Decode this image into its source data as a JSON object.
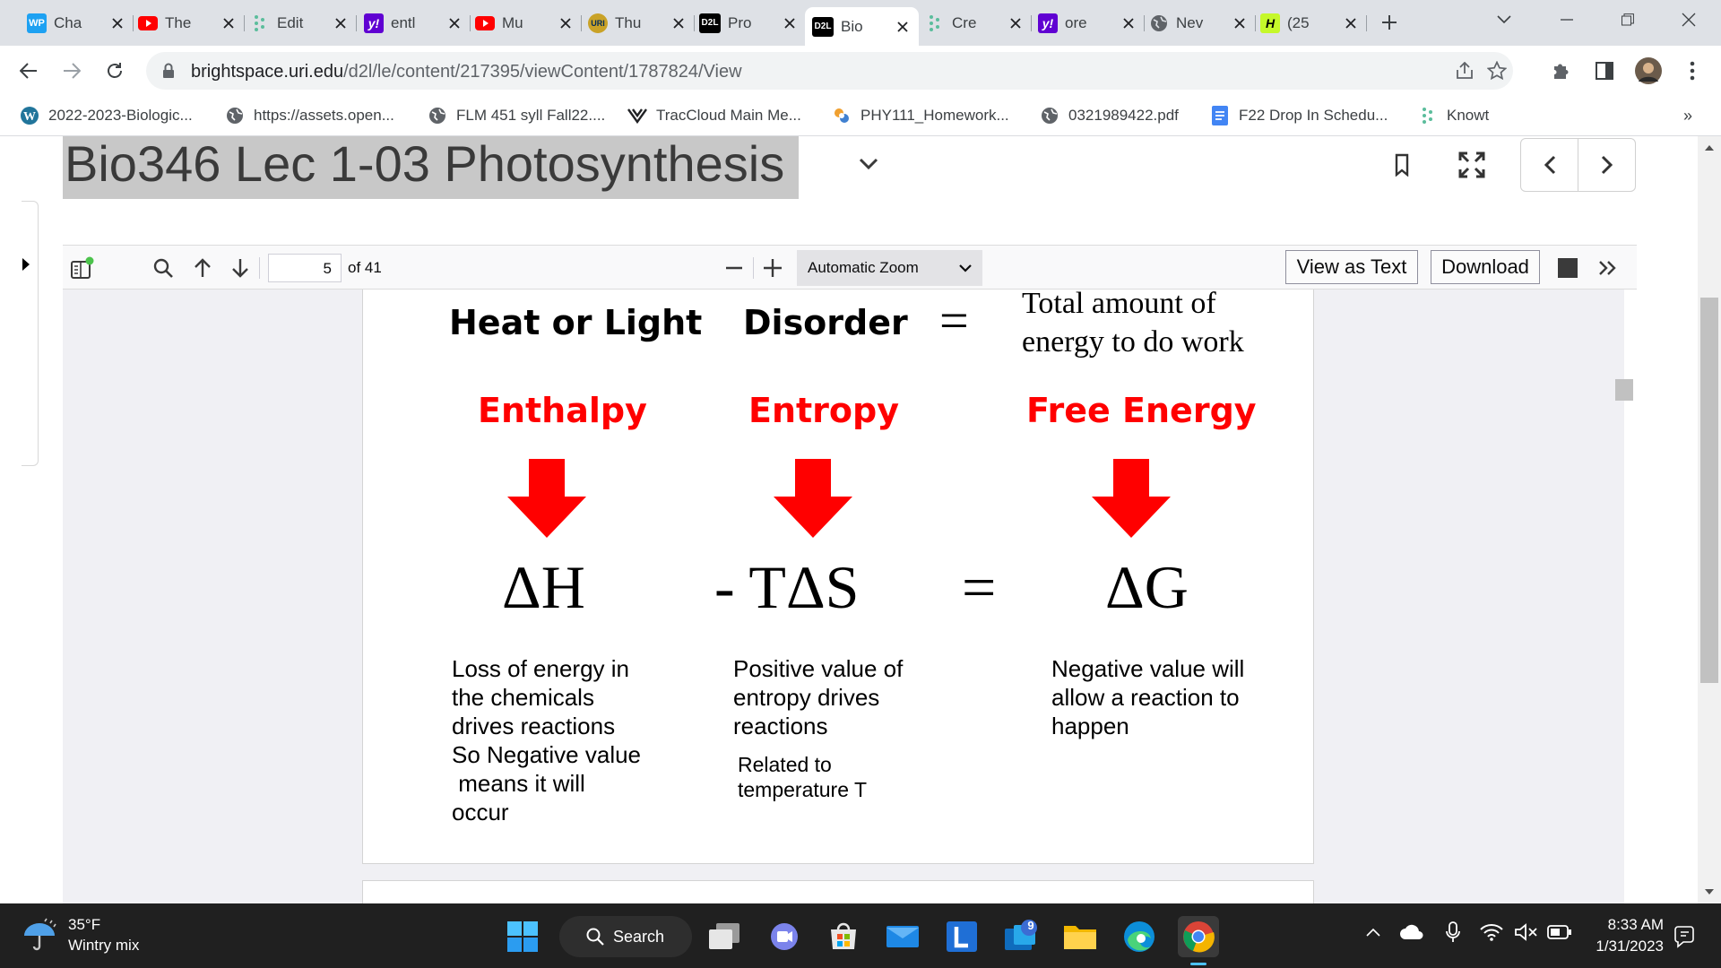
{
  "browser": {
    "tabs": [
      {
        "title": "Cha",
        "favicon": "WP",
        "fav_bg": "#1da1f2",
        "fav_fg": "#ffffff"
      },
      {
        "title": "The",
        "favicon": "youtube-icon",
        "fav_bg": "#ff0000",
        "fav_fg": "#ffffff"
      },
      {
        "title": "Edit",
        "favicon": "knowt-icon",
        "fav_bg": "transparent",
        "fav_fg": "#5bbd9c"
      },
      {
        "title": "entl",
        "favicon": "y!",
        "fav_bg": "#6001d2",
        "fav_fg": "#ffffff"
      },
      {
        "title": "Mu",
        "favicon": "youtube-icon",
        "fav_bg": "#ff0000",
        "fav_fg": "#ffffff"
      },
      {
        "title": "Thu",
        "favicon": "URI",
        "fav_bg": "#c9a227",
        "fav_fg": "#002b5c"
      },
      {
        "title": "Pro",
        "favicon": "D2L",
        "fav_bg": "#000000",
        "fav_fg": "#ffffff"
      },
      {
        "title": "Bio",
        "favicon": "D2L",
        "fav_bg": "#000000",
        "fav_fg": "#ffffff",
        "active": true
      },
      {
        "title": "Cre",
        "favicon": "knowt-icon",
        "fav_bg": "transparent",
        "fav_fg": "#5bbd9c"
      },
      {
        "title": "ore",
        "favicon": "y!",
        "fav_bg": "#6001d2",
        "fav_fg": "#ffffff"
      },
      {
        "title": "Nev",
        "favicon": "globe-icon",
        "fav_bg": "transparent",
        "fav_fg": "#5f6368"
      },
      {
        "title": "(25",
        "favicon": "H",
        "fav_bg": "#c5f82a",
        "fav_fg": "#000000"
      }
    ],
    "url_host": "brightspace.uri.edu",
    "url_path": "/d2l/le/content/217395/viewContent/1787824/View",
    "bookmarks": [
      {
        "label": "2022-2023-Biologic...",
        "icon": "wordpress-icon"
      },
      {
        "label": "https://assets.open...",
        "icon": "globe-icon"
      },
      {
        "label": "FLM 451 syll Fall22....",
        "icon": "globe-icon"
      },
      {
        "label": "TracCloud Main Me...",
        "icon": "traccloud-icon"
      },
      {
        "label": "PHY111_Homework...",
        "icon": "homework-icon"
      },
      {
        "label": "0321989422.pdf",
        "icon": "globe-icon"
      },
      {
        "label": "F22 Drop In Schedu...",
        "icon": "docs-icon"
      },
      {
        "label": "Knowt",
        "icon": "knowt-icon"
      }
    ],
    "bookmarks_overflow": "»"
  },
  "page": {
    "doc_title": "Bio346 Lec 1-03 Photosynthesis"
  },
  "pdf": {
    "current_page": "5",
    "page_count": "of 41",
    "zoom": "Automatic Zoom",
    "view_as_text": "View as Text",
    "download": "Download",
    "overflow": "»"
  },
  "slide": {
    "headers": {
      "heat": "Heat or Light",
      "disorder": "Disorder",
      "equals": "=",
      "total_line1": "Total amount of",
      "total_line2": "energy to do work"
    },
    "labels": {
      "enthalpy": "Enthalpy",
      "entropy": "Entropy",
      "free_energy": "Free Energy"
    },
    "symbols": {
      "dh": "ΔH",
      "tds": "- TΔS",
      "equals": "=",
      "dg": "ΔG"
    },
    "descriptions": {
      "enthalpy": [
        "Loss of energy in",
        "the chemicals",
        "drives reactions",
        "So Negative value",
        " means it will",
        "occur"
      ],
      "entropy": [
        "Positive value of",
        "entropy drives",
        "reactions"
      ],
      "entropy_note": [
        "Related to",
        "temperature T"
      ],
      "free_energy": [
        "Negative value will",
        "allow a reaction to",
        "happen"
      ]
    },
    "colors": {
      "accent": "#ff0000"
    }
  },
  "taskbar": {
    "weather_temp": "35°F",
    "weather_desc": "Wintry mix",
    "search_label": "Search",
    "mail_badge": "9",
    "time": "8:33 AM",
    "date": "1/31/2023"
  }
}
